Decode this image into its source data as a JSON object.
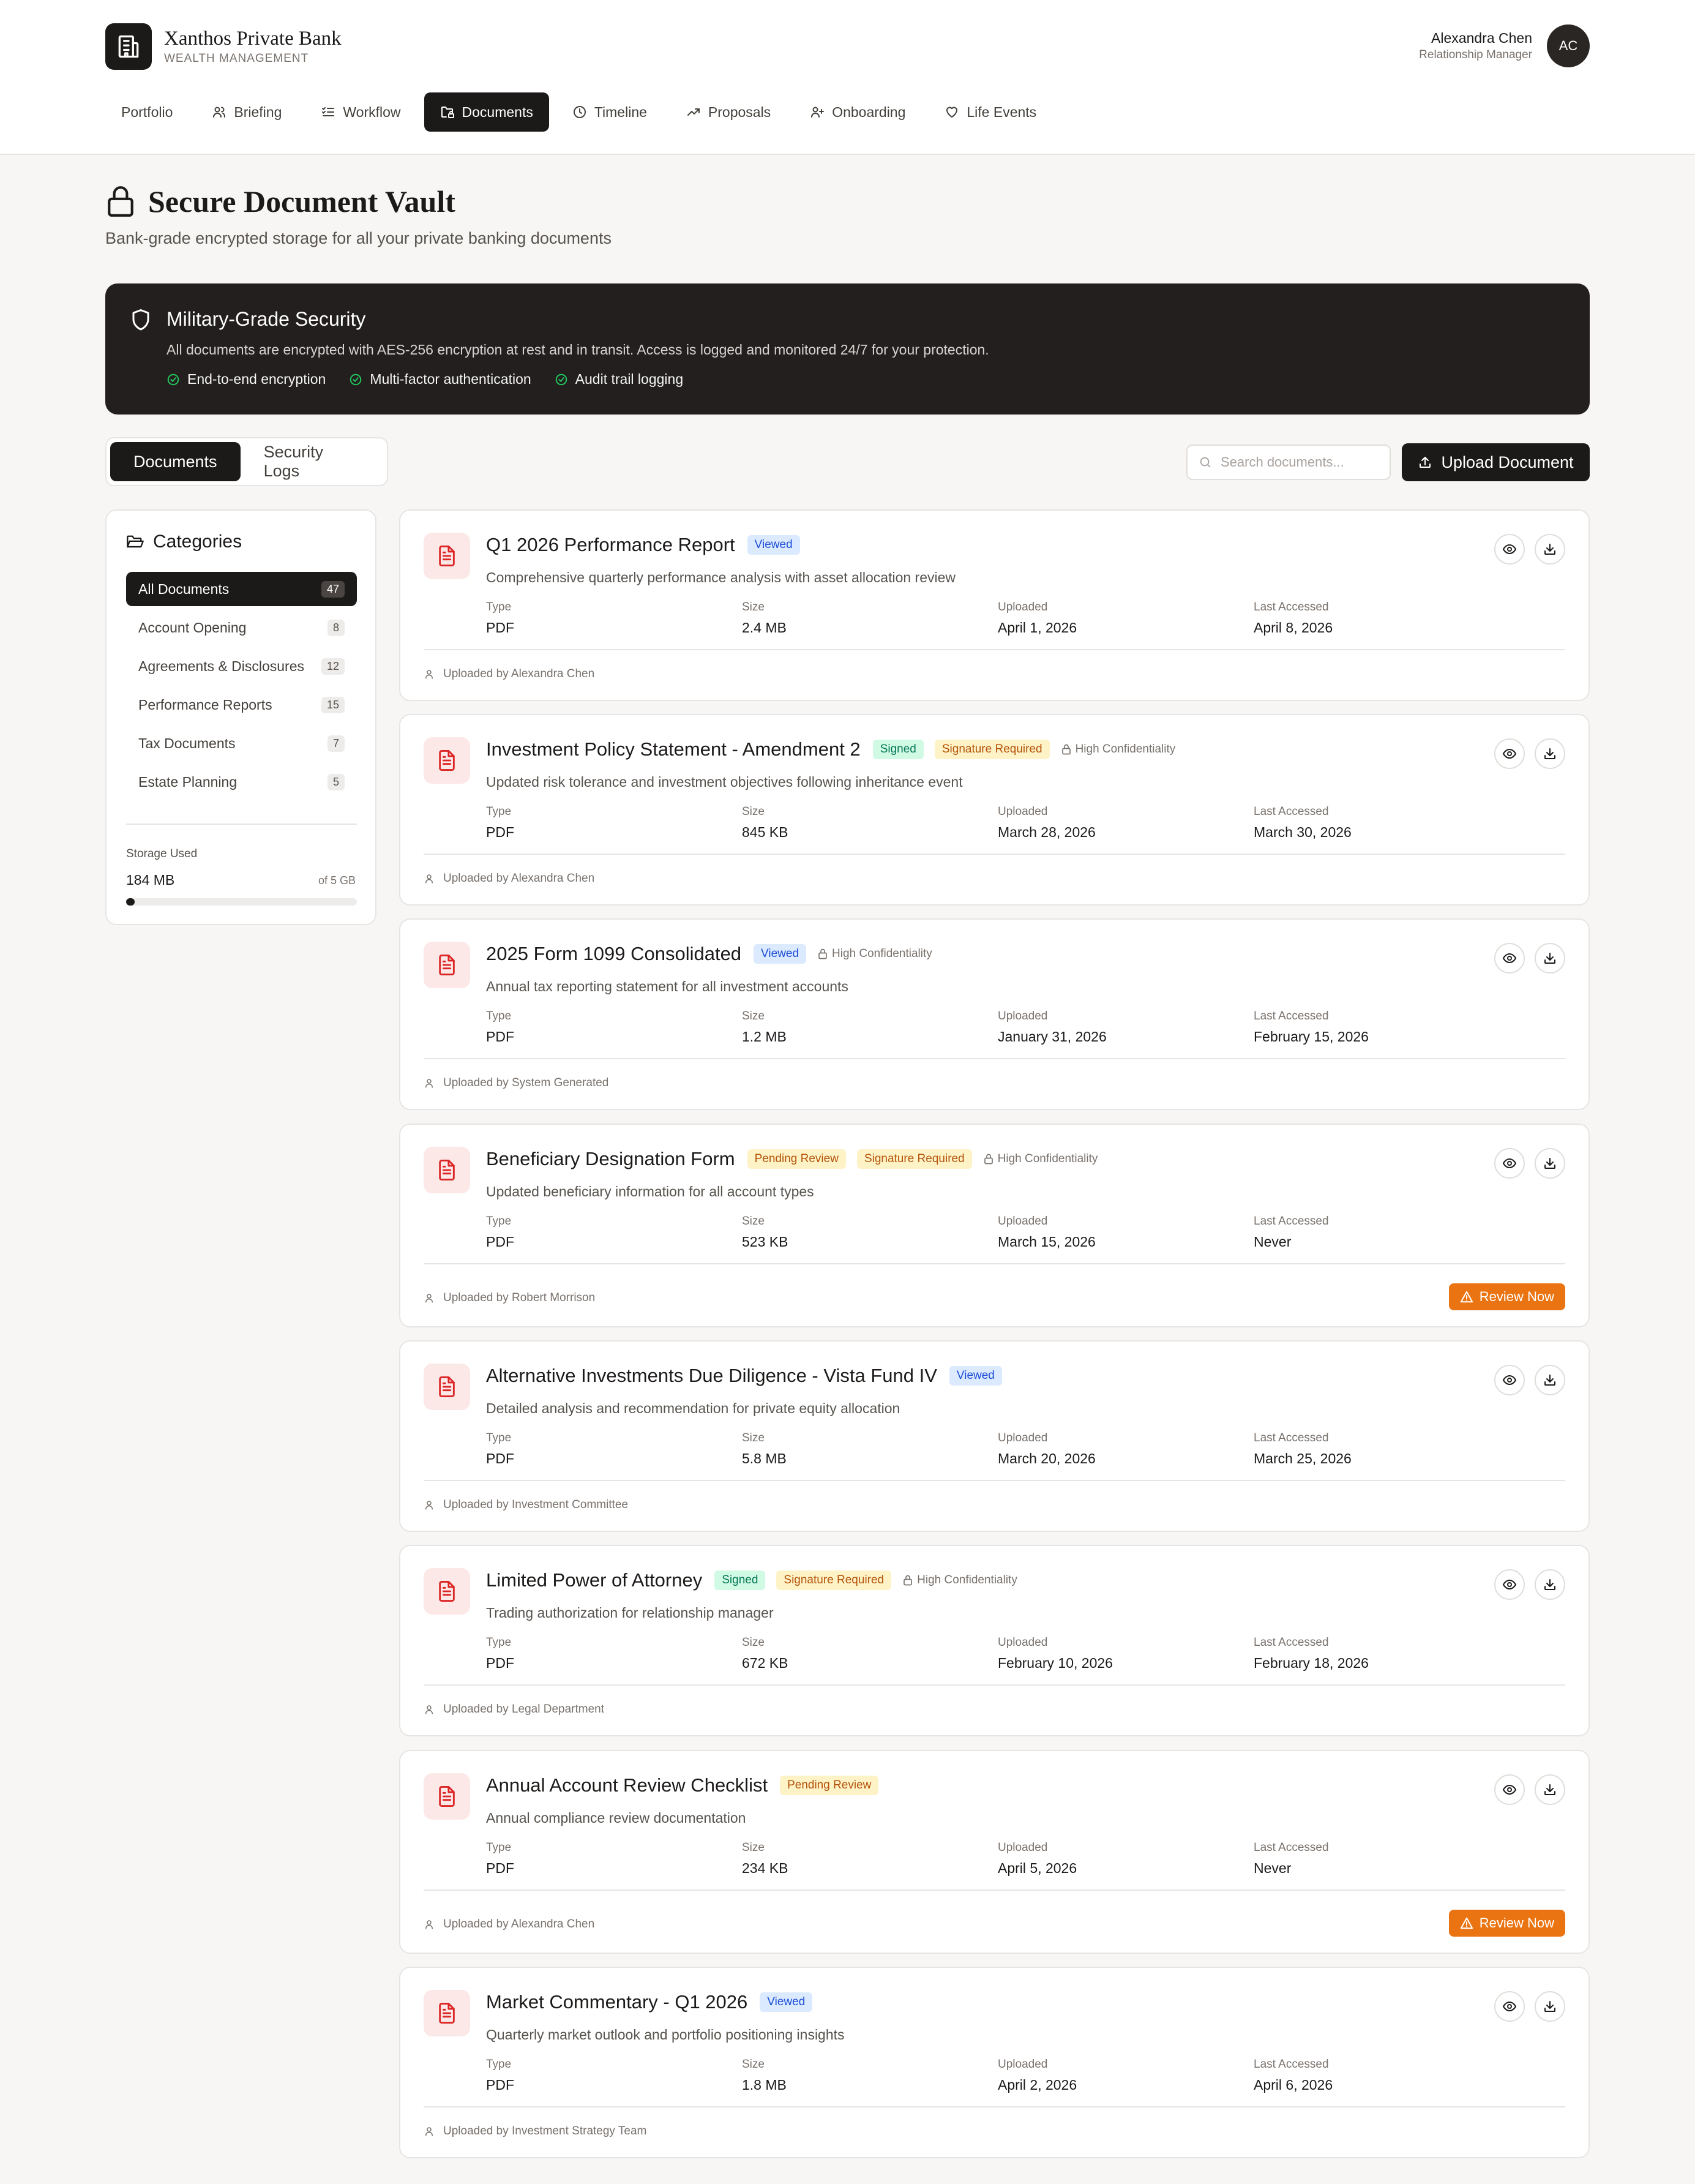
{
  "colors": {
    "primary": "#1c1a19",
    "accent_orange": "#ea7412",
    "doc_icon": "#dc2626",
    "check_green": "#22c55e"
  },
  "app": {
    "bank_name": "Xanthos Private Bank",
    "bank_sub": "WEALTH MANAGEMENT",
    "logo_icon": "building-icon"
  },
  "user": {
    "name": "Alexandra Chen",
    "role": "Relationship Manager",
    "initials": "AC"
  },
  "nav": [
    {
      "label": "Portfolio",
      "icon": "",
      "active": false
    },
    {
      "label": "Briefing",
      "icon": "users-icon",
      "active": false
    },
    {
      "label": "Workflow",
      "icon": "list-check-icon",
      "active": false
    },
    {
      "label": "Documents",
      "icon": "folder-lock-icon",
      "active": true
    },
    {
      "label": "Timeline",
      "icon": "clock-icon",
      "active": false
    },
    {
      "label": "Proposals",
      "icon": "trending-up-icon",
      "active": false
    },
    {
      "label": "Onboarding",
      "icon": "user-plus-icon",
      "active": false
    },
    {
      "label": "Life Events",
      "icon": "heart-icon",
      "active": false
    }
  ],
  "page": {
    "title": "Secure Document Vault",
    "subtitle": "Bank-grade encrypted storage for all your private banking documents"
  },
  "security_banner": {
    "title": "Military-Grade Security",
    "text": "All documents are encrypted with AES-256 encryption at rest and in transit. Access is logged and monitored 24/7 for your protection.",
    "features": [
      "End-to-end encryption",
      "Multi-factor authentication",
      "Audit trail logging"
    ]
  },
  "tabs": [
    {
      "label": "Documents",
      "active": true
    },
    {
      "label": "Security Logs",
      "active": false
    }
  ],
  "search": {
    "placeholder": "Search documents...",
    "value": ""
  },
  "upload_label": "Upload Document",
  "sidebar": {
    "title": "Categories",
    "categories": [
      {
        "label": "All Documents",
        "count": "47",
        "active": true
      },
      {
        "label": "Account Opening",
        "count": "8",
        "active": false
      },
      {
        "label": "Agreements & Disclosures",
        "count": "12",
        "active": false
      },
      {
        "label": "Performance Reports",
        "count": "15",
        "active": false
      },
      {
        "label": "Tax Documents",
        "count": "7",
        "active": false
      },
      {
        "label": "Estate Planning",
        "count": "5",
        "active": false
      }
    ],
    "storage": {
      "label": "Storage Used",
      "used": "184 MB",
      "total": "of 5 GB",
      "fraction": 0.036
    }
  },
  "meta_labels": {
    "type": "Type",
    "size": "Size",
    "uploaded": "Uploaded",
    "last_accessed": "Last Accessed"
  },
  "review_label": "Review Now",
  "documents": [
    {
      "title": "Q1 2026 Performance Report",
      "badges": [
        {
          "label": "Viewed",
          "kind": "viewed"
        }
      ],
      "confidential": "",
      "description": "Comprehensive quarterly performance analysis with asset allocation review",
      "type": "PDF",
      "size": "2.4 MB",
      "uploaded": "April 1, 2026",
      "last_accessed": "April 8, 2026",
      "uploaded_by": "Uploaded by Alexandra Chen",
      "review": false
    },
    {
      "title": "Investment Policy Statement - Amendment 2",
      "badges": [
        {
          "label": "Signed",
          "kind": "signed"
        },
        {
          "label": "Signature Required",
          "kind": "sigreq"
        }
      ],
      "confidential": "High Confidentiality",
      "description": "Updated risk tolerance and investment objectives following inheritance event",
      "type": "PDF",
      "size": "845 KB",
      "uploaded": "March 28, 2026",
      "last_accessed": "March 30, 2026",
      "uploaded_by": "Uploaded by Alexandra Chen",
      "review": false
    },
    {
      "title": "2025 Form 1099 Consolidated",
      "badges": [
        {
          "label": "Viewed",
          "kind": "viewed"
        }
      ],
      "confidential": "High Confidentiality",
      "description": "Annual tax reporting statement for all investment accounts",
      "type": "PDF",
      "size": "1.2 MB",
      "uploaded": "January 31, 2026",
      "last_accessed": "February 15, 2026",
      "uploaded_by": "Uploaded by System Generated",
      "review": false
    },
    {
      "title": "Beneficiary Designation Form",
      "badges": [
        {
          "label": "Pending Review",
          "kind": "pending"
        },
        {
          "label": "Signature Required",
          "kind": "sigreq"
        }
      ],
      "confidential": "High Confidentiality",
      "description": "Updated beneficiary information for all account types",
      "type": "PDF",
      "size": "523 KB",
      "uploaded": "March 15, 2026",
      "last_accessed": "Never",
      "uploaded_by": "Uploaded by Robert Morrison",
      "review": true
    },
    {
      "title": "Alternative Investments Due Diligence - Vista Fund IV",
      "badges": [
        {
          "label": "Viewed",
          "kind": "viewed"
        }
      ],
      "confidential": "",
      "description": "Detailed analysis and recommendation for private equity allocation",
      "type": "PDF",
      "size": "5.8 MB",
      "uploaded": "March 20, 2026",
      "last_accessed": "March 25, 2026",
      "uploaded_by": "Uploaded by Investment Committee",
      "review": false
    },
    {
      "title": "Limited Power of Attorney",
      "badges": [
        {
          "label": "Signed",
          "kind": "signed"
        },
        {
          "label": "Signature Required",
          "kind": "sigreq"
        }
      ],
      "confidential": "High Confidentiality",
      "description": "Trading authorization for relationship manager",
      "type": "PDF",
      "size": "672 KB",
      "uploaded": "February 10, 2026",
      "last_accessed": "February 18, 2026",
      "uploaded_by": "Uploaded by Legal Department",
      "review": false
    },
    {
      "title": "Annual Account Review Checklist",
      "badges": [
        {
          "label": "Pending Review",
          "kind": "pending"
        }
      ],
      "confidential": "",
      "description": "Annual compliance review documentation",
      "type": "PDF",
      "size": "234 KB",
      "uploaded": "April 5, 2026",
      "last_accessed": "Never",
      "uploaded_by": "Uploaded by Alexandra Chen",
      "review": true
    },
    {
      "title": "Market Commentary - Q1 2026",
      "badges": [
        {
          "label": "Viewed",
          "kind": "viewed"
        }
      ],
      "confidential": "",
      "description": "Quarterly market outlook and portfolio positioning insights",
      "type": "PDF",
      "size": "1.8 MB",
      "uploaded": "April 2, 2026",
      "last_accessed": "April 6, 2026",
      "uploaded_by": "Uploaded by Investment Strategy Team",
      "review": false
    }
  ]
}
